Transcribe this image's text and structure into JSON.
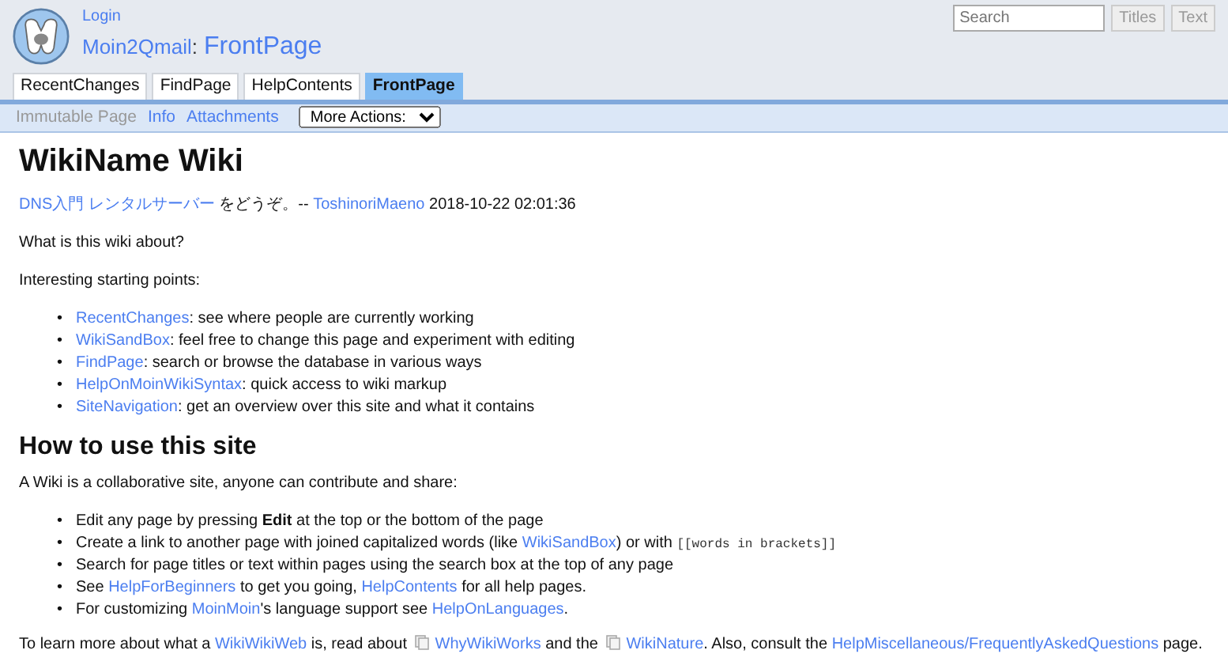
{
  "header": {
    "login": "Login",
    "site_name": "Moin2Qmail",
    "separator": ":",
    "page_title": "FrontPage"
  },
  "search": {
    "placeholder": "Search",
    "buttons": [
      {
        "label": "Titles",
        "disabled": true
      },
      {
        "label": "Text",
        "disabled": true
      }
    ]
  },
  "tabs": [
    {
      "label": "RecentChanges",
      "selected": false
    },
    {
      "label": "FindPage",
      "selected": false
    },
    {
      "label": "HelpContents",
      "selected": false
    },
    {
      "label": "FrontPage",
      "selected": true
    }
  ],
  "actions": [
    {
      "label": "Immutable Page",
      "disabled": true
    },
    {
      "label": "Info",
      "disabled": false
    },
    {
      "label": "Attachments",
      "disabled": false
    }
  ],
  "more_actions": {
    "value": "More Actions:"
  },
  "content": [
    {
      "kind": "heading",
      "text": "WikiName Wiki"
    },
    {
      "kind": "paragraph",
      "segments": [
        {
          "kind": "link",
          "text": "DNS入門 レンタルサーバー"
        },
        {
          "kind": "text",
          "text": " をどうぞ。-- "
        },
        {
          "kind": "link",
          "text": "ToshinoriMaeno"
        },
        {
          "kind": "text",
          "text": " 2018-10-22 02:01:36"
        }
      ]
    },
    {
      "kind": "paragraph",
      "segments": [
        {
          "kind": "text",
          "text": "What is this wiki about?"
        }
      ]
    },
    {
      "kind": "paragraph",
      "segments": [
        {
          "kind": "text",
          "text": "Interesting starting points:"
        }
      ]
    },
    {
      "kind": "list",
      "marker": "•",
      "items": [
        [
          {
            "kind": "link",
            "text": "RecentChanges"
          },
          {
            "kind": "text",
            "text": ": see where people are currently working"
          }
        ],
        [
          {
            "kind": "link",
            "text": "WikiSandBox"
          },
          {
            "kind": "text",
            "text": ": feel free to change this page and experiment with editing"
          }
        ],
        [
          {
            "kind": "link",
            "text": "FindPage"
          },
          {
            "kind": "text",
            "text": ": search or browse the database in various ways"
          }
        ],
        [
          {
            "kind": "link",
            "text": "HelpOnMoinWikiSyntax"
          },
          {
            "kind": "text",
            "text": ": quick access to wiki markup"
          }
        ],
        [
          {
            "kind": "link",
            "text": "SiteNavigation"
          },
          {
            "kind": "text",
            "text": ": get an overview over this site and what it contains"
          }
        ]
      ]
    },
    {
      "kind": "heading",
      "text": "How to use this site"
    },
    {
      "kind": "paragraph",
      "segments": [
        {
          "kind": "text",
          "text": "A Wiki is a collaborative site, anyone can contribute and share:"
        }
      ]
    },
    {
      "kind": "list",
      "marker": "•",
      "items": [
        [
          {
            "kind": "text",
            "text": "Edit any page by pressing "
          },
          {
            "kind": "bold",
            "text": "Edit"
          },
          {
            "kind": "text",
            "text": " at the top or the bottom of the page"
          }
        ],
        [
          {
            "kind": "text",
            "text": "Create a link to another page with joined capitalized words (like "
          },
          {
            "kind": "link",
            "text": "WikiSandBox"
          },
          {
            "kind": "text",
            "text": ") or with "
          },
          {
            "kind": "code",
            "text": "[[words in brackets]]"
          }
        ],
        [
          {
            "kind": "text",
            "text": "Search for page titles or text within pages using the search box at the top of any page"
          }
        ],
        [
          {
            "kind": "text",
            "text": "See "
          },
          {
            "kind": "link",
            "text": "HelpForBeginners"
          },
          {
            "kind": "text",
            "text": " to get you going, "
          },
          {
            "kind": "link",
            "text": "HelpContents"
          },
          {
            "kind": "text",
            "text": " for all help pages."
          }
        ],
        [
          {
            "kind": "text",
            "text": "For customizing "
          },
          {
            "kind": "link",
            "text": "MoinMoin"
          },
          {
            "kind": "text",
            "text": "'s language support see "
          },
          {
            "kind": "link",
            "text": "HelpOnLanguages"
          },
          {
            "kind": "text",
            "text": "."
          }
        ]
      ]
    },
    {
      "kind": "paragraph",
      "segments": [
        {
          "kind": "text",
          "text": "To learn more about what a "
        },
        {
          "kind": "link",
          "text": "WikiWikiWeb"
        },
        {
          "kind": "text",
          "text": " is, read about "
        },
        {
          "kind": "iconlink",
          "text": "WhyWikiWorks"
        },
        {
          "kind": "text",
          "text": " and the "
        },
        {
          "kind": "iconlink",
          "text": "WikiNature"
        },
        {
          "kind": "text",
          "text": ". Also, consult the "
        },
        {
          "kind": "link",
          "text": "HelpMiscellaneous/FrequentlyAskedQuestions"
        },
        {
          "kind": "text",
          "text": " page."
        }
      ]
    }
  ]
}
